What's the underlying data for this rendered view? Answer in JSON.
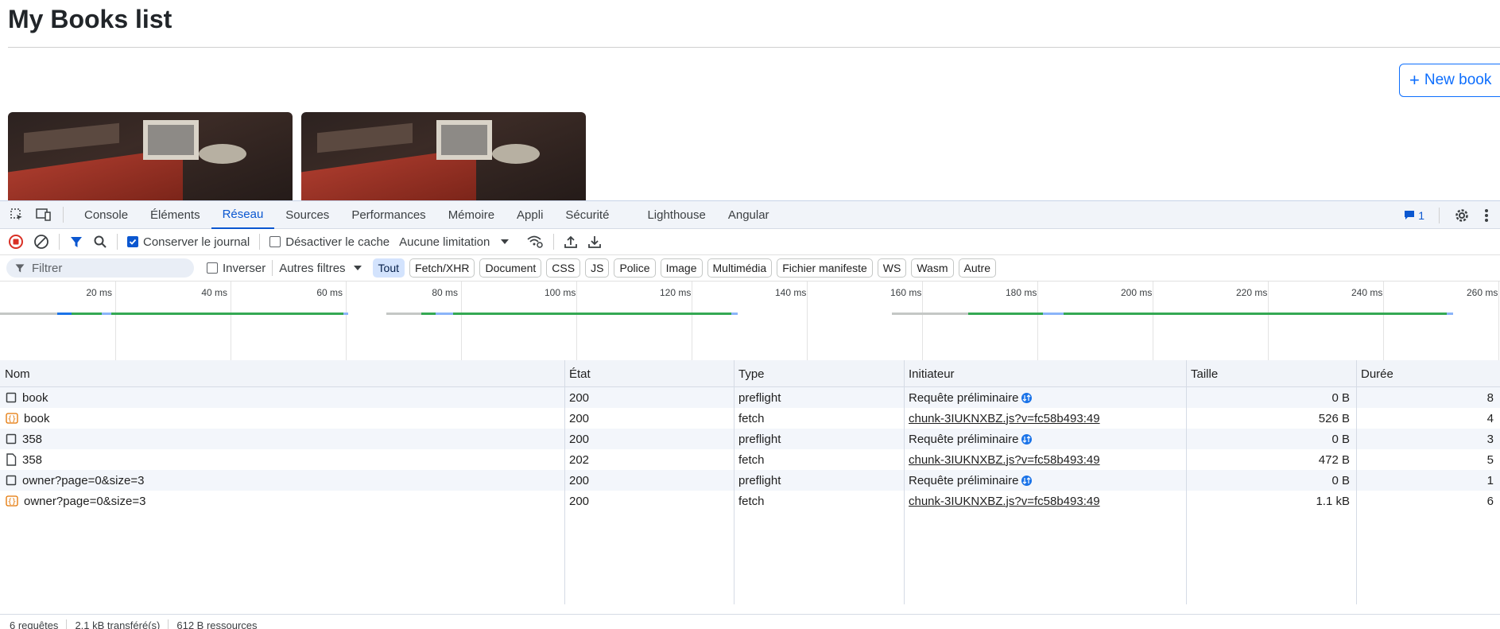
{
  "page": {
    "title": "My Books list",
    "new_book_label": "New book"
  },
  "devtools": {
    "tabs": [
      "Console",
      "Éléments",
      "Réseau",
      "Sources",
      "Performances",
      "Mémoire",
      "Appli",
      "Sécurité",
      "Lighthouse",
      "Angular"
    ],
    "active_tab": "Réseau",
    "issues_count": "1",
    "toolbar": {
      "preserve_log": "Conserver le journal",
      "preserve_log_checked": true,
      "disable_cache": "Désactiver le cache",
      "disable_cache_checked": false,
      "throttling": "Aucune limitation"
    },
    "filterbar": {
      "placeholder": "Filtrer",
      "invert": "Inverser",
      "more_filters": "Autres filtres",
      "types": [
        "Tout",
        "Fetch/XHR",
        "Document",
        "CSS",
        "JS",
        "Police",
        "Image",
        "Multimédia",
        "Fichier manifeste",
        "WS",
        "Wasm",
        "Autre"
      ],
      "active_type": "Tout"
    },
    "timeline": {
      "ticks": [
        "20 ms",
        "40 ms",
        "60 ms",
        "80 ms",
        "100 ms",
        "120 ms",
        "140 ms",
        "160 ms",
        "180 ms",
        "200 ms",
        "220 ms",
        "240 ms",
        "260 ms"
      ]
    },
    "table": {
      "columns": [
        "Nom",
        "État",
        "Type",
        "Initiateur",
        "Taille",
        "Durée"
      ],
      "rows": [
        {
          "icon": "document-icon",
          "name": "book",
          "status": "200",
          "type": "preflight",
          "initiator": "Requête préliminaire",
          "size": "0 B",
          "time": "8"
        },
        {
          "icon": "fetch-icon",
          "name": "book",
          "status": "200",
          "type": "fetch",
          "initiator": "chunk-3IUKNXBZ.js?v=fc58b493:49",
          "size": "526 B",
          "time": "4"
        },
        {
          "icon": "document-icon",
          "name": "358",
          "status": "200",
          "type": "preflight",
          "initiator": "Requête préliminaire",
          "size": "0 B",
          "time": "3"
        },
        {
          "icon": "file-icon",
          "name": "358",
          "status": "202",
          "type": "fetch",
          "initiator": "chunk-3IUKNXBZ.js?v=fc58b493:49",
          "size": "472 B",
          "time": "5"
        },
        {
          "icon": "document-icon",
          "name": "owner?page=0&size=3",
          "status": "200",
          "type": "preflight",
          "initiator": "Requête préliminaire",
          "size": "0 B",
          "time": "1"
        },
        {
          "icon": "fetch-icon",
          "name": "owner?page=0&size=3",
          "status": "200",
          "type": "fetch",
          "initiator": "chunk-3IUKNXBZ.js?v=fc58b493:49",
          "size": "1.1 kB",
          "time": "6"
        }
      ]
    },
    "status": {
      "requests": "6 requêtes",
      "transferred": "2.1 kB transféré(s)",
      "resources": "612 B ressources"
    }
  }
}
